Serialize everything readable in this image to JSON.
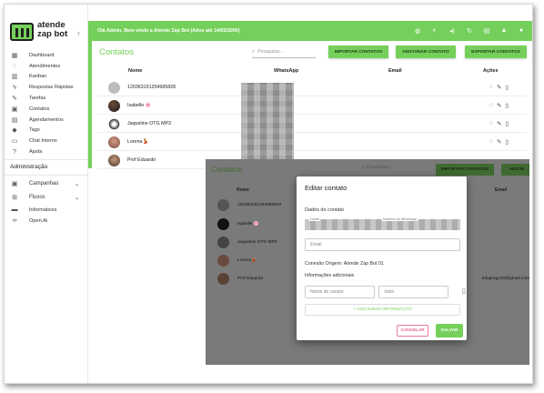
{
  "app": {
    "logo_line1": "atende",
    "logo_line2": "zap bot",
    "greeting": "Olá Admin, Bem vindo a Atende Zap Bot (Ativo até 14/03/2050)"
  },
  "sidebar": {
    "items": [
      {
        "label": "Dashboard",
        "icon": "dashboard-icon",
        "glyph": "▦"
      },
      {
        "label": "Atendimentos",
        "icon": "whatsapp-icon",
        "glyph": "◌"
      },
      {
        "label": "Kanban",
        "icon": "kanban-icon",
        "glyph": "▥"
      },
      {
        "label": "Respostas Rápidas",
        "icon": "bolt-icon",
        "glyph": "ϟ"
      },
      {
        "label": "Tarefas",
        "icon": "edit-icon",
        "glyph": "✎"
      },
      {
        "label": "Contatos",
        "icon": "contacts-icon",
        "glyph": "▣"
      },
      {
        "label": "Agendamentos",
        "icon": "calendar-icon",
        "glyph": "▤"
      },
      {
        "label": "Tags",
        "icon": "tag-icon",
        "glyph": "◆"
      },
      {
        "label": "Chat Interno",
        "icon": "chat-icon",
        "glyph": "▭"
      },
      {
        "label": "Ajuda",
        "icon": "help-icon",
        "glyph": "?"
      }
    ],
    "section_title": "Administração",
    "admin_items": [
      {
        "label": "Campanhas",
        "icon": "campaign-icon",
        "glyph": "▣",
        "expandable": true
      },
      {
        "label": "Fluxos",
        "icon": "flow-icon",
        "glyph": "⊞",
        "expandable": true
      },
      {
        "label": "Informativos",
        "icon": "info-icon",
        "glyph": "▬"
      },
      {
        "label": "Open.Ai",
        "icon": "infinity-icon",
        "glyph": "∞"
      }
    ]
  },
  "topbar_icons": [
    "globe-icon",
    "circle-half-icon",
    "volume-icon",
    "refresh-icon",
    "chat-icon",
    "bell-icon",
    "user-icon"
  ],
  "contacts": {
    "title": "Contatos",
    "search_placeholder": "Pesquisar...",
    "import_button": "IMPORTAR CONTATOS",
    "add_button": "ADICIONAR CONTATO",
    "export_button": "EXPORTAR CONTATOS",
    "columns": {
      "name": "Nome",
      "whatsapp": "WhatsApp",
      "email": "Email",
      "actions": "Ações"
    },
    "rows": [
      {
        "name": "120363151254995828"
      },
      {
        "name": "Isabelle 🌸"
      },
      {
        "name": "Jaqueline OTG MP3"
      },
      {
        "name": "Lorena💃"
      },
      {
        "name": "Prof Eduardo"
      }
    ]
  },
  "background_table": {
    "email_example": "eduprog100@gmail.com",
    "add_button_partial": "ADICIO"
  },
  "dialog": {
    "title": "Editar contato",
    "section_contact": "Dados do contato",
    "name_label": "Nome",
    "number_label": "Número do Whatsapp",
    "email_placeholder": "Email",
    "connection_text": "Conexão Origem: Atende Zap Bot 01",
    "additional_info": "Informações adicionais",
    "field_name_placeholder": "Nome do campo",
    "field_value_placeholder": "Valor",
    "add_info_button": "+ ADICIONAR INFORMAÇÃO",
    "cancel_button": "CANCELAR",
    "save_button": "SALVAR"
  },
  "colors": {
    "accent": "#74d05a",
    "cancel": "#d81b60"
  }
}
